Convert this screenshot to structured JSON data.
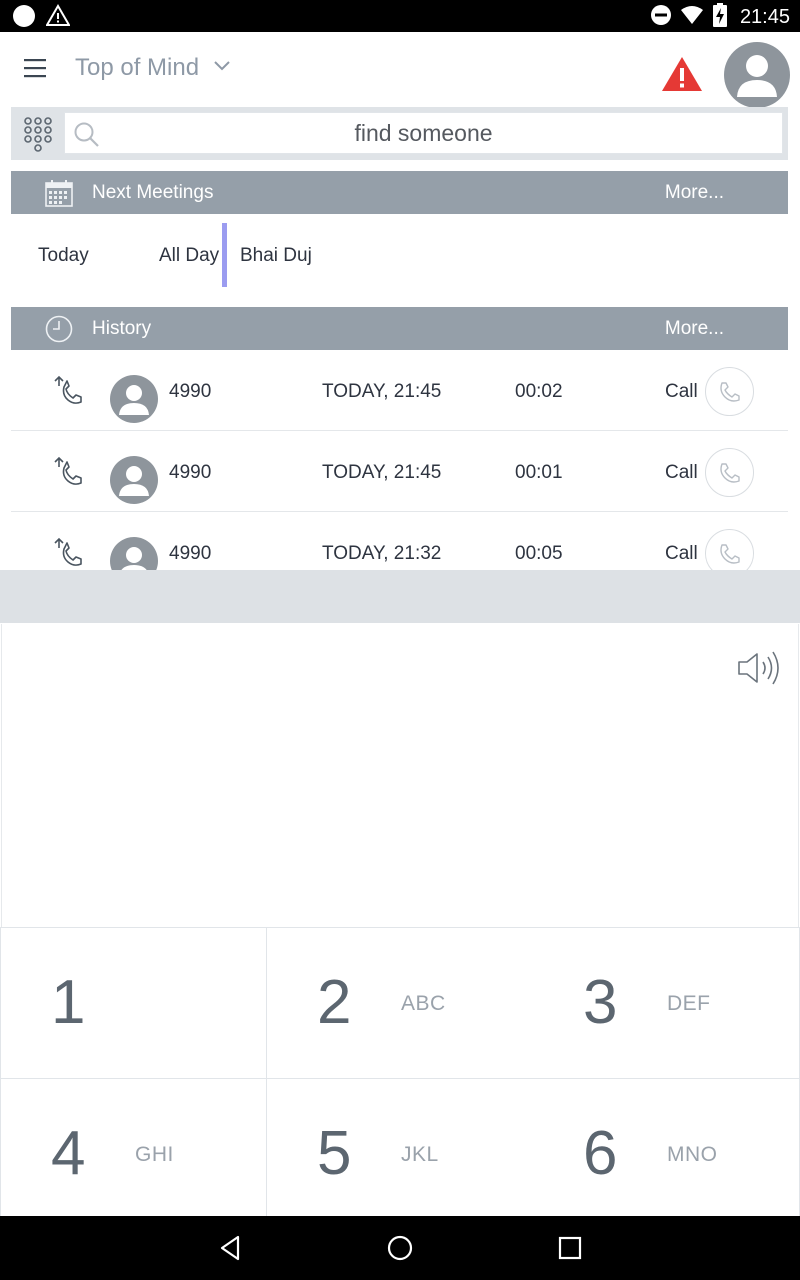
{
  "status_bar": {
    "time": "21:45",
    "icons": [
      "notification-dot-icon",
      "warning-icon",
      "do-not-disturb-icon",
      "wifi-icon",
      "battery-charging-icon"
    ]
  },
  "header": {
    "title": "Top of Mind",
    "icons": [
      "hamburger-menu-icon",
      "chevron-down-icon",
      "alert-triangle-icon",
      "user-avatar-icon"
    ],
    "alert_color": "#e53935"
  },
  "search": {
    "placeholder": "find someone"
  },
  "meetings": {
    "header_label": "Next Meetings",
    "more_label": "More...",
    "items": [
      {
        "day": "Today",
        "time": "All Day",
        "title": "Bhai Duj"
      }
    ],
    "accent_color": "#9b9cf0"
  },
  "history": {
    "header_label": "History",
    "more_label": "More...",
    "rows": [
      {
        "number": "4990",
        "when": "TODAY, 21:45",
        "duration": "00:02",
        "action": "Call"
      },
      {
        "number": "4990",
        "when": "TODAY, 21:45",
        "duration": "00:01",
        "action": "Call"
      },
      {
        "number": "4990",
        "when": "TODAY, 21:32",
        "duration": "00:05",
        "action": "Call"
      }
    ]
  },
  "dialer": {
    "speaker_icon": "speaker-icon",
    "keys": [
      {
        "digit": "1",
        "letters": ""
      },
      {
        "digit": "2",
        "letters": "ABC"
      },
      {
        "digit": "3",
        "letters": "DEF"
      },
      {
        "digit": "4",
        "letters": "GHI"
      },
      {
        "digit": "5",
        "letters": "JKL"
      },
      {
        "digit": "6",
        "letters": "MNO"
      }
    ]
  },
  "nav_bar": {
    "icons": [
      "back-icon",
      "home-icon",
      "recents-icon"
    ]
  },
  "colors": {
    "section_bar": "#959fa9",
    "text_dark": "#2e3440",
    "title_gray": "#8e99a6"
  }
}
